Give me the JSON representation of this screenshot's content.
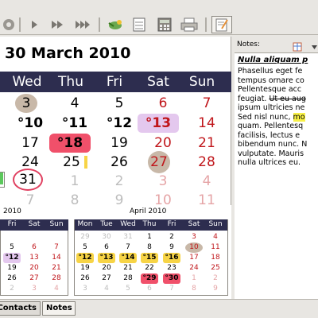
{
  "main": {
    "date_title": "30 March 2010",
    "weekday_headers": [
      "Wed",
      "Thu",
      "Fri",
      "Sat",
      "Sun"
    ],
    "weeks": [
      [
        "3",
        "4",
        "5",
        "6",
        "7"
      ],
      [
        "°10",
        "°11",
        "°12",
        "°13",
        "14"
      ],
      [
        "17",
        "°18",
        "19",
        "20",
        "21"
      ],
      [
        "24",
        "25",
        "26",
        "27",
        "28"
      ],
      [
        "31",
        "1",
        "2",
        "3",
        "4"
      ],
      [
        "7",
        "8",
        "9",
        "10",
        "11"
      ]
    ]
  },
  "mini_prev": {
    "title": "2010",
    "headers": [
      "Fri",
      "Sat",
      "Sun"
    ],
    "rows": [
      [
        "",
        "",
        ""
      ],
      [
        "5",
        "6",
        "7"
      ],
      [
        "°12",
        "13",
        "14"
      ],
      [
        "19",
        "20",
        "21"
      ],
      [
        "26",
        "27",
        "28"
      ],
      [
        "2",
        "3",
        "4"
      ]
    ]
  },
  "mini_april": {
    "title": "April 2010",
    "headers": [
      "Mon",
      "Tue",
      "Wed",
      "Thu",
      "Fri",
      "Sat",
      "Sun"
    ],
    "rows": [
      [
        "29",
        "30",
        "31",
        "1",
        "2",
        "3",
        "4"
      ],
      [
        "5",
        "6",
        "7",
        "8",
        "9",
        "10",
        "11"
      ],
      [
        "°12",
        "°13",
        "°14",
        "°15",
        "°16",
        "17",
        "18"
      ],
      [
        "19",
        "20",
        "21",
        "22",
        "23",
        "24",
        "25"
      ],
      [
        "26",
        "27",
        "28",
        "°29",
        "°30",
        "1",
        "2"
      ],
      [
        "3",
        "4",
        "5",
        "6",
        "7",
        "8",
        "9"
      ]
    ]
  },
  "notes": {
    "label": "Notes:",
    "heading": "Nulla aliquam p",
    "lines": [
      "Phasellus eget fe",
      "tempus ornare co",
      "Pellentesque acc",
      "feugiat. Ut eu aug",
      "ipsum ultricies ne",
      "Sed nisl nunc, mo",
      "quam. Pellentesq",
      "facilisis, lectus e",
      "bibendum nunc. N",
      "vulputate. Mauris",
      "nulla ultrices eu."
    ],
    "strike_text": "Ut eu aug",
    "strike_prefix": "feugiat. ",
    "mark_prefix": "Sed nisl nunc, ",
    "mark_text": "mo"
  },
  "tabs": [
    "Contacts",
    "Notes"
  ],
  "colors": {
    "header_bg": "#2d2d4f",
    "weekend_red": "#c0151a",
    "highlight_red": "#f0506a",
    "highlight_yellow": "#f7d446",
    "highlight_purple": "#e4c8ee"
  }
}
